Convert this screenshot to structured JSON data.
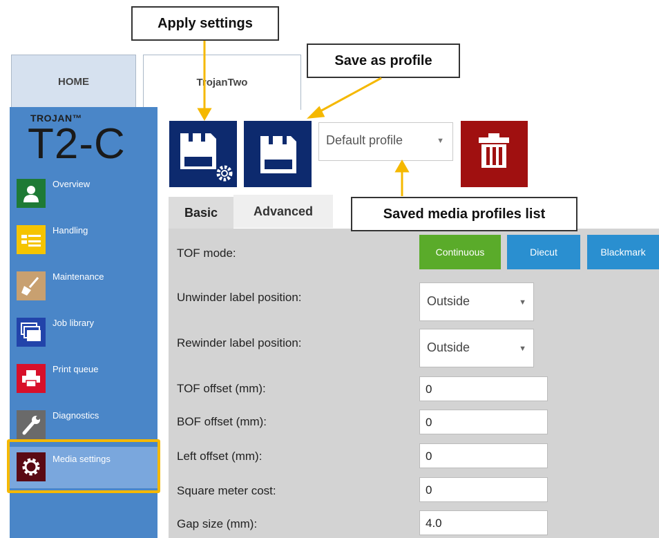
{
  "tabs": {
    "home": "HOME",
    "device": "TrojanTwo"
  },
  "brand": {
    "small": "TROJAN™",
    "model": "T2-C"
  },
  "sidebar": {
    "items": [
      {
        "label": "Overview",
        "icon": "person-icon",
        "color": "#1e7a35"
      },
      {
        "label": "Handling",
        "icon": "handling-icon",
        "color": "#f5c400"
      },
      {
        "label": "Maintenance",
        "icon": "broom-icon",
        "color": "#c8a070"
      },
      {
        "label": "Job library",
        "icon": "stack-icon",
        "color": "#2244aa"
      },
      {
        "label": "Print queue",
        "icon": "printer-icon",
        "color": "#d8102a"
      },
      {
        "label": "Diagnostics",
        "icon": "wrench-icon",
        "color": "#6a6a6a"
      },
      {
        "label": "Media settings",
        "icon": "gear-icon",
        "color": "#5a0a14"
      }
    ]
  },
  "toolbar": {
    "profile_selected": "Default profile"
  },
  "settings_tabs": {
    "basic": "Basic",
    "advanced": "Advanced"
  },
  "settings": {
    "tof_mode": {
      "label": "TOF mode:",
      "options": [
        "Continuous",
        "Diecut",
        "Blackmark"
      ],
      "selected": "Continuous"
    },
    "unwinder": {
      "label": "Unwinder label position:",
      "value": "Outside"
    },
    "rewinder": {
      "label": "Rewinder label position:",
      "value": "Outside"
    },
    "tof_offset": {
      "label": "TOF offset (mm):",
      "value": "0"
    },
    "bof_offset": {
      "label": "BOF offset (mm):",
      "value": "0"
    },
    "left_offset": {
      "label": "Left offset (mm):",
      "value": "0"
    },
    "sqm_cost": {
      "label": "Square meter cost:",
      "value": "0"
    },
    "gap_size": {
      "label": "Gap size (mm):",
      "value": "4.0"
    }
  },
  "callouts": {
    "apply": "Apply settings",
    "save": "Save as profile",
    "profiles": "Saved media profiles list"
  },
  "colors": {
    "sidebar": "#4a86c8",
    "navy": "#0d2a6e",
    "delete": "#a01010",
    "continuous": "#5aab2a",
    "tof_other": "#2a8fd0",
    "highlight": "#f5b800",
    "arrow": "#f5b800"
  }
}
